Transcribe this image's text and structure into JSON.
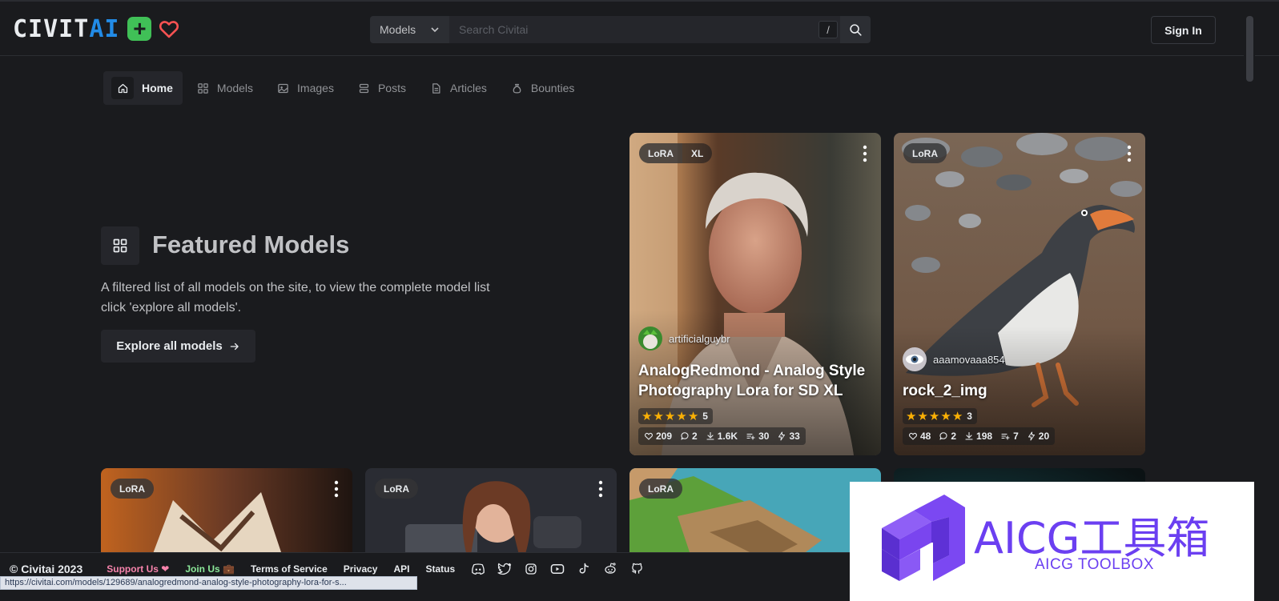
{
  "header": {
    "logo_text_a": "CIVIT",
    "logo_text_b": "AI",
    "search_type": "Models",
    "search_placeholder": "Search Civitai",
    "slash_key": "/",
    "signin_label": "Sign In"
  },
  "nav": {
    "items": [
      {
        "label": "Home",
        "icon": "home-icon"
      },
      {
        "label": "Models",
        "icon": "grid-icon"
      },
      {
        "label": "Images",
        "icon": "image-icon"
      },
      {
        "label": "Posts",
        "icon": "posts-icon"
      },
      {
        "label": "Articles",
        "icon": "article-icon"
      },
      {
        "label": "Bounties",
        "icon": "moneybag-icon"
      }
    ]
  },
  "featured": {
    "title": "Featured Models",
    "description": "A filtered list of all models on the site, to view the complete model list click 'explore all models'.",
    "explore_label": "Explore all models"
  },
  "cards": [
    {
      "type": "LoRA",
      "base": "XL",
      "user": "artificialguybr",
      "title": "AnalogRedmond - Analog Style Photography Lora for SD XL",
      "rating_count": "5",
      "likes": "209",
      "comments": "2",
      "downloads": "1.6K",
      "collections": "30",
      "buzz": "33"
    },
    {
      "type": "LoRA",
      "user": "aaamovaaa854",
      "title": "rock_2_img",
      "rating_count": "3",
      "likes": "48",
      "comments": "2",
      "downloads": "198",
      "collections": "7",
      "buzz": "20"
    },
    {
      "type": "LoRA"
    },
    {
      "type": "LoRA"
    },
    {
      "type": "LoRA"
    }
  ],
  "footer": {
    "copyright": "© Civitai 2023",
    "support": "Support Us ❤",
    "join": "Join Us 💼",
    "terms": "Terms of Service",
    "privacy": "Privacy",
    "api": "API",
    "status": "Status",
    "socials": [
      "discord-icon",
      "twitter-icon",
      "instagram-icon",
      "youtube-icon",
      "tiktok-icon",
      "reddit-icon",
      "github-icon"
    ]
  },
  "status_url": "https://civitai.com/models/129689/analogredmond-analog-style-photography-lora-for-s...",
  "watermark": {
    "title": "AICG工具箱",
    "subtitle": "AICG TOOLBOX"
  },
  "colors": {
    "background": "#1a1b1e",
    "accent_blue": "#228be6",
    "accent_green": "#40c057",
    "star": "#fab005",
    "watermark_purple": "#6b3ff1"
  }
}
